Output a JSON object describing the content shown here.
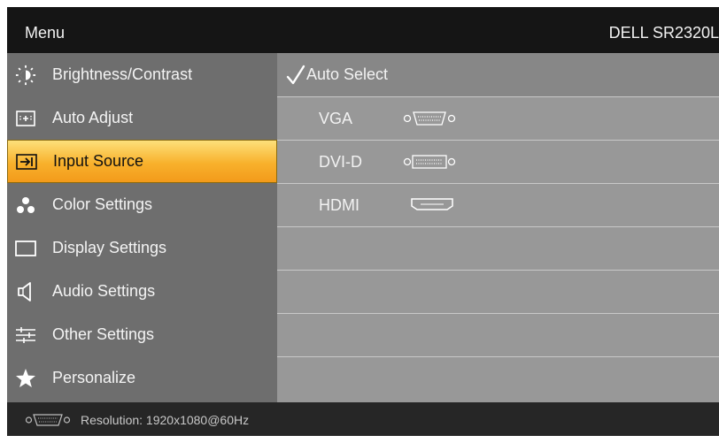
{
  "header": {
    "menu_title": "Menu",
    "model": "DELL SR2320L"
  },
  "sidebar": {
    "items": [
      {
        "label": "Brightness/Contrast",
        "icon": "brightness-icon"
      },
      {
        "label": "Auto Adjust",
        "icon": "auto-adjust-icon"
      },
      {
        "label": "Input Source",
        "icon": "input-source-icon",
        "selected": true
      },
      {
        "label": "Color Settings",
        "icon": "color-settings-icon"
      },
      {
        "label": "Display Settings",
        "icon": "display-settings-icon"
      },
      {
        "label": "Audio Settings",
        "icon": "speaker-icon"
      },
      {
        "label": "Other Settings",
        "icon": "sliders-icon"
      },
      {
        "label": "Personalize",
        "icon": "star-icon"
      }
    ]
  },
  "panel": {
    "options": [
      {
        "label": "Auto Select",
        "checked": true
      },
      {
        "label": "VGA",
        "icon": "vga-port-icon"
      },
      {
        "label": "DVI-D",
        "icon": "dvi-port-icon"
      },
      {
        "label": "HDMI",
        "icon": "hdmi-port-icon"
      }
    ]
  },
  "footer": {
    "resolution": "Resolution: 1920x1080@60Hz",
    "icon": "vga-port-icon"
  },
  "colors": {
    "selected_bg": "#f8b12c",
    "sidebar_bg": "#6e6e6e",
    "panel_bg": "#989898",
    "header_bg": "#151515"
  }
}
